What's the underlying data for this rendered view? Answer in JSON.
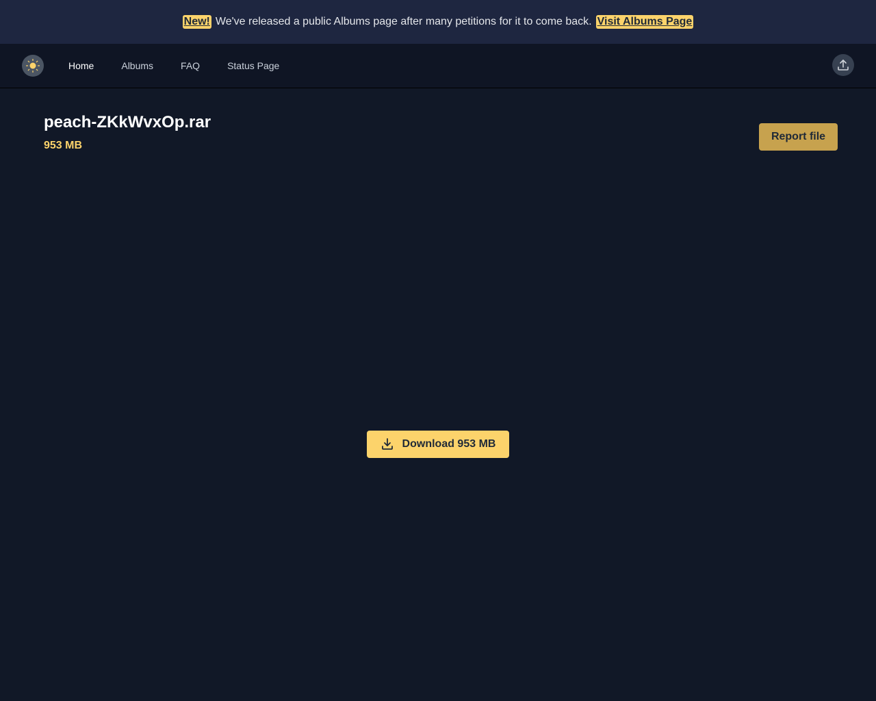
{
  "banner": {
    "badge": "New!",
    "message": "We've released a public Albums page after many petitions for it to come back.",
    "link_label": "Visit Albums Page"
  },
  "nav": {
    "logo_icon": "sun-logo-icon",
    "items": [
      {
        "label": "Home",
        "active": true
      },
      {
        "label": "Albums",
        "active": false
      },
      {
        "label": "FAQ",
        "active": false
      },
      {
        "label": "Status Page",
        "active": false
      }
    ],
    "upload_icon": "upload-icon"
  },
  "file": {
    "name": "peach-ZKkWvxOp.rar",
    "size": "953 MB"
  },
  "actions": {
    "report_label": "Report file",
    "download_label": "Download 953 MB",
    "download_icon": "download-icon"
  },
  "colors": {
    "accent": "#fcd36b",
    "report_button": "#c7a24e",
    "background": "#111827",
    "navbar": "#0f1524",
    "banner": "#1e2640"
  }
}
